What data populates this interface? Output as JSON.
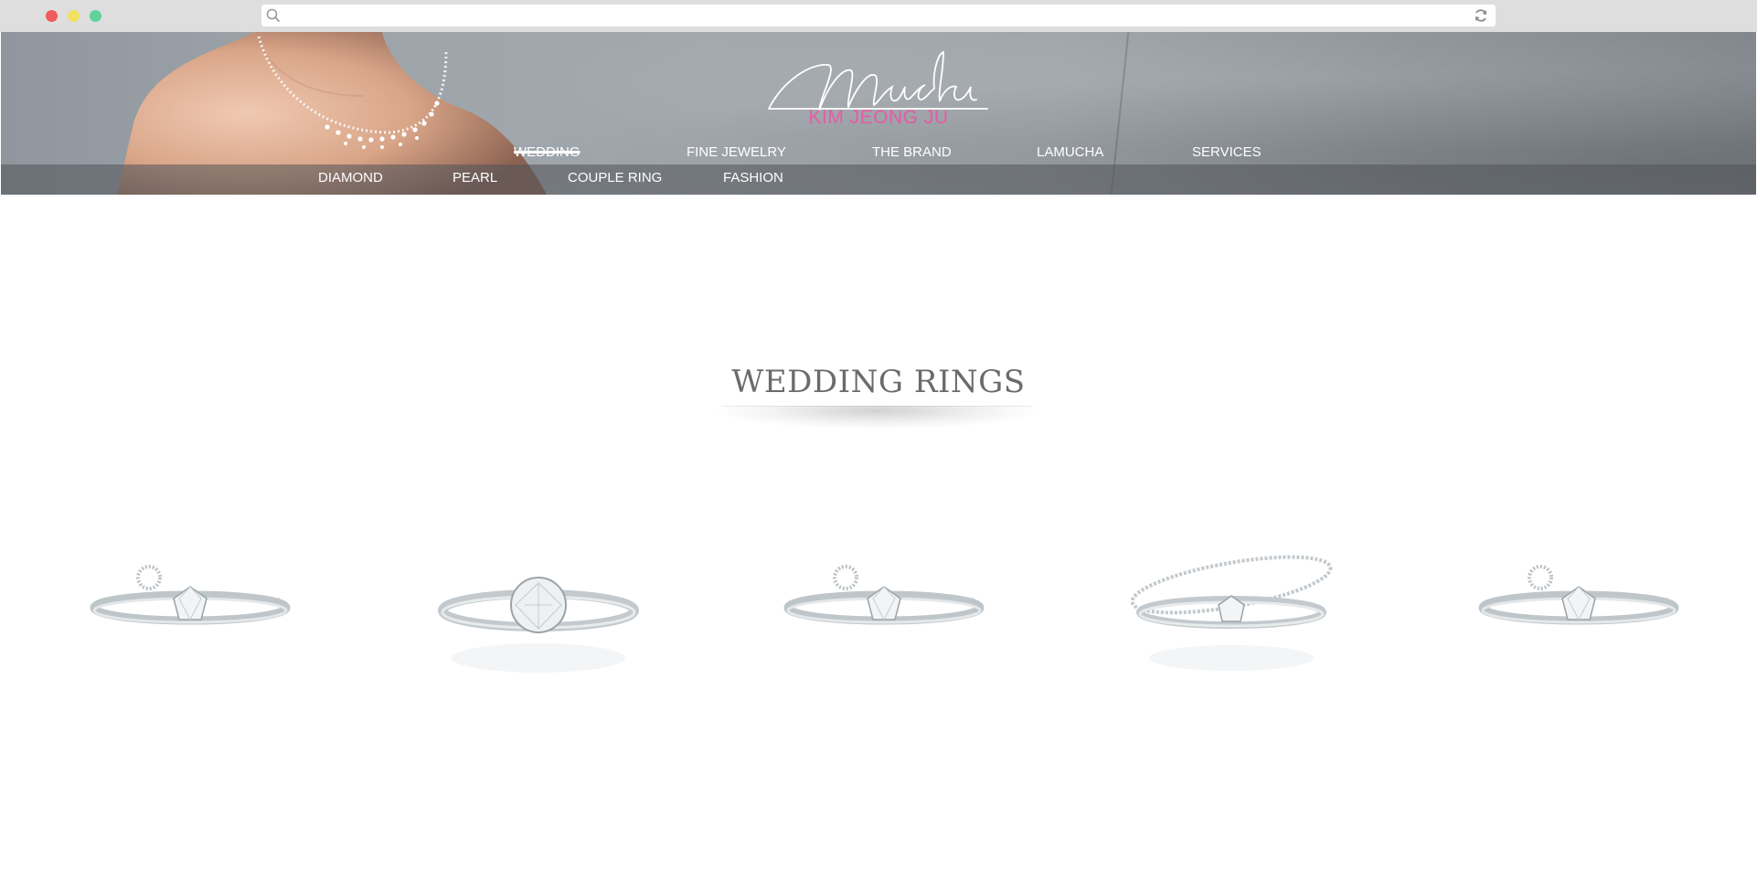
{
  "browser": {
    "url": "",
    "dots": [
      "close",
      "minimize",
      "maximize"
    ]
  },
  "brand": {
    "logo_script": "Mucha",
    "subtitle": "KIM JEONG JU",
    "accent": "#e85aa8"
  },
  "nav": {
    "main": [
      {
        "label": "WEDDING",
        "active": true
      },
      {
        "label": "FINE JEWELRY",
        "active": false
      },
      {
        "label": "THE BRAND",
        "active": false
      },
      {
        "label": "LAMUCHA",
        "active": false
      },
      {
        "label": "SERVICES",
        "active": false
      }
    ],
    "sub": [
      {
        "label": "DIAMOND"
      },
      {
        "label": "PEARL"
      },
      {
        "label": "COUPLE RING"
      },
      {
        "label": "FASHION"
      }
    ]
  },
  "content": {
    "title": "WEDDING RINGS",
    "products": [
      {
        "name": "ring-1-icon"
      },
      {
        "name": "ring-2-icon"
      },
      {
        "name": "ring-3-icon"
      },
      {
        "name": "ring-4-icon"
      },
      {
        "name": "ring-5-icon"
      }
    ]
  }
}
